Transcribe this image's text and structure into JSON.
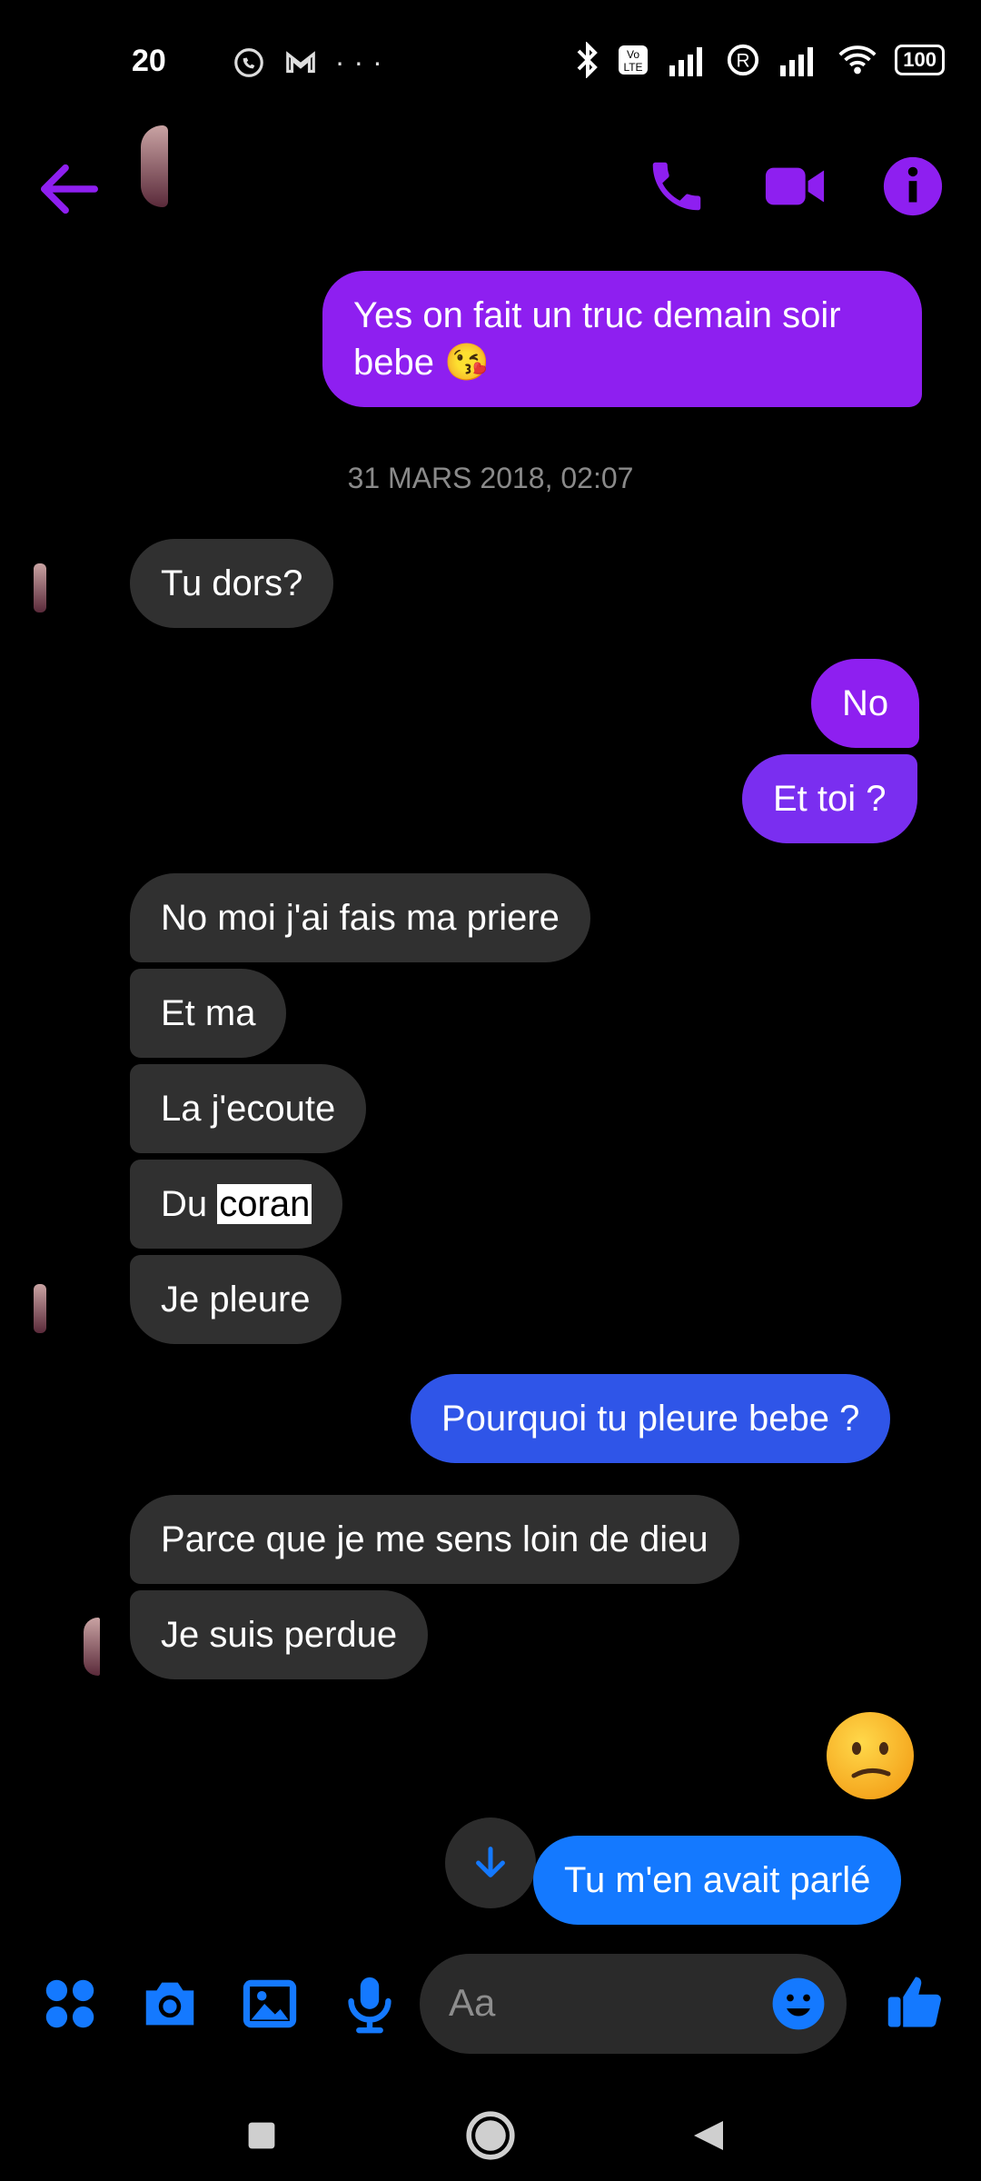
{
  "status_bar": {
    "time": "20",
    "icons": [
      "whatsapp-icon",
      "gmail-icon",
      "more-icon"
    ],
    "battery": "100",
    "right_icons": [
      "bluetooth-icon",
      "volte-icon",
      "signal-icon",
      "roaming-icon",
      "signal-icon",
      "wifi-icon"
    ]
  },
  "header": {
    "back_icon": "back-arrow-icon",
    "actions": [
      "phone-icon",
      "video-icon",
      "info-icon"
    ],
    "accent": "#8e1ff0"
  },
  "messages": [
    {
      "side": "out",
      "text": "Yes on fait un truc demain soir bebe 😘"
    },
    {
      "type": "date",
      "text": "31 MARS 2018, 02:07"
    },
    {
      "side": "in",
      "text": "Tu dors?"
    },
    {
      "side": "out",
      "text": "No"
    },
    {
      "side": "out",
      "text": "Et toi ?"
    },
    {
      "side": "in",
      "text": "No moi j'ai fais ma priere"
    },
    {
      "side": "in",
      "text": "Et ma"
    },
    {
      "side": "in",
      "text": "La j'ecoute"
    },
    {
      "side": "in",
      "text_prefix": "Du ",
      "text_highlight": "coran"
    },
    {
      "side": "in",
      "text": "Je pleure"
    },
    {
      "side": "out",
      "text": "Pourquoi tu pleure bebe ?"
    },
    {
      "side": "in",
      "text": "Parce que je me sens loin de dieu"
    },
    {
      "side": "in",
      "text": "Je suis perdue"
    },
    {
      "side": "out",
      "type": "emoji",
      "emoji": "confused-face"
    },
    {
      "side": "out",
      "text": "Tu m'en avait parlé"
    }
  ],
  "composer": {
    "placeholder": "Aa",
    "tools": [
      "apps-icon",
      "camera-icon",
      "gallery-icon",
      "mic-icon"
    ],
    "send_icon": "thumbs-up-icon",
    "accent": "#1479ff"
  },
  "nav": {
    "buttons": [
      "recents-icon",
      "home-icon",
      "back-icon"
    ]
  }
}
